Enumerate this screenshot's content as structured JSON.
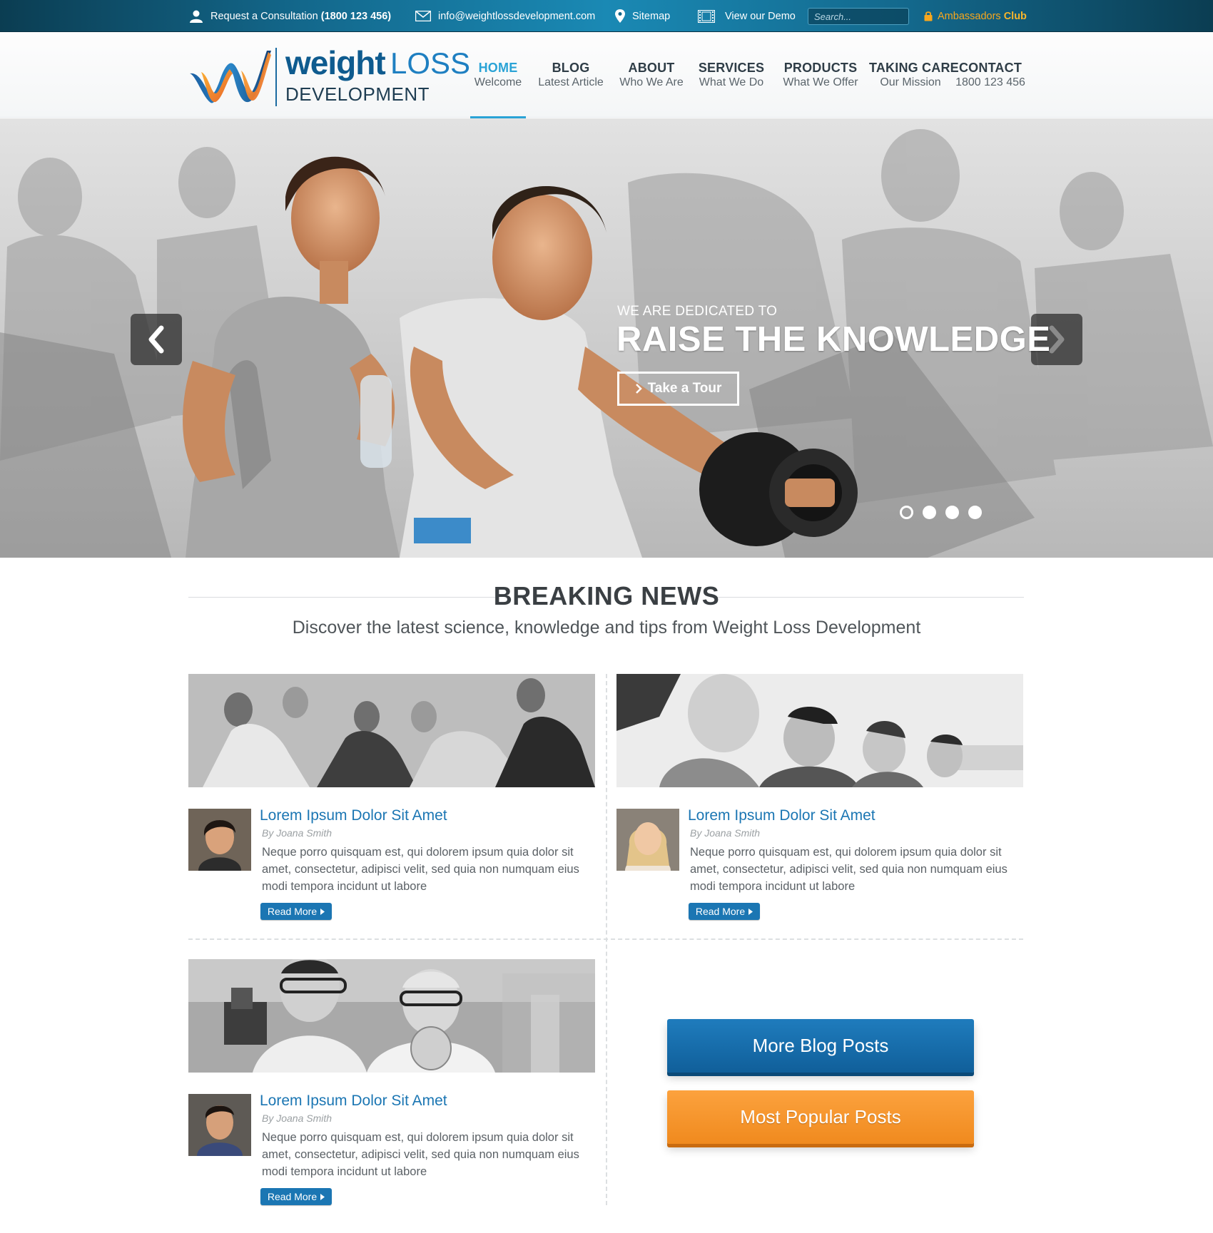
{
  "topbar": {
    "consult_label": "Request a Consultation",
    "consult_phone": "(1800 123 456)",
    "email": "info@weightlossdevelopment.com",
    "sitemap": "Sitemap",
    "demo": "View our Demo",
    "search_placeholder": "Search...",
    "ambassadors_label": "Ambassadors",
    "ambassadors_club": "Club"
  },
  "logo": {
    "word1": "weight",
    "word2": "LOSS",
    "word3": "DEVELOPMENT"
  },
  "nav": [
    {
      "title": "HOME",
      "sub": "Welcome"
    },
    {
      "title": "BLOG",
      "sub": "Latest Article"
    },
    {
      "title": "ABOUT",
      "sub": "Who We Are"
    },
    {
      "title": "SERVICES",
      "sub": "What We Do"
    },
    {
      "title": "PRODUCTS",
      "sub": "What We Offer"
    },
    {
      "title": "TAKING CARE",
      "sub": "Our Mission"
    },
    {
      "title": "CONTACT",
      "sub": "1800 123 456"
    }
  ],
  "hero": {
    "kicker": "WE ARE DEDICATED TO",
    "title": "RAISE THE KNOWLEDGE",
    "cta": "Take a Tour",
    "slide_count": 4,
    "active_slide": 1
  },
  "news": {
    "title": "BREAKING NEWS",
    "subtitle": "Discover the latest science, knowledge and tips from Weight Loss Development",
    "posts": [
      {
        "title": "Lorem Ipsum Dolor Sit Amet",
        "author": "By Joana Smith",
        "body": "Neque porro quisquam est, qui dolorem ipsum quia dolor sit amet, consectetur, adipisci velit, sed quia non numquam eius modi tempora incidunt ut labore",
        "read_more": "Read More"
      },
      {
        "title": "Lorem Ipsum Dolor Sit Amet",
        "author": "By Joana Smith",
        "body": "Neque porro quisquam est, qui dolorem ipsum quia dolor sit amet, consectetur, adipisci velit, sed quia non numquam eius modi tempora incidunt ut labore",
        "read_more": "Read More"
      },
      {
        "title": "Lorem Ipsum Dolor Sit Amet",
        "author": "By Joana Smith",
        "body": "Neque porro quisquam est, qui dolorem ipsum quia dolor sit amet, consectetur, adipisci velit, sed quia non numquam eius modi tempora incidunt ut labore",
        "read_more": "Read More"
      }
    ],
    "more_posts": "More Blog Posts",
    "popular_posts": "Most Popular Posts"
  },
  "colors": {
    "accent": "#2aa3d6",
    "link_blue": "#1b76b3",
    "orange": "#f08a1e",
    "topbar": "#13688c"
  }
}
